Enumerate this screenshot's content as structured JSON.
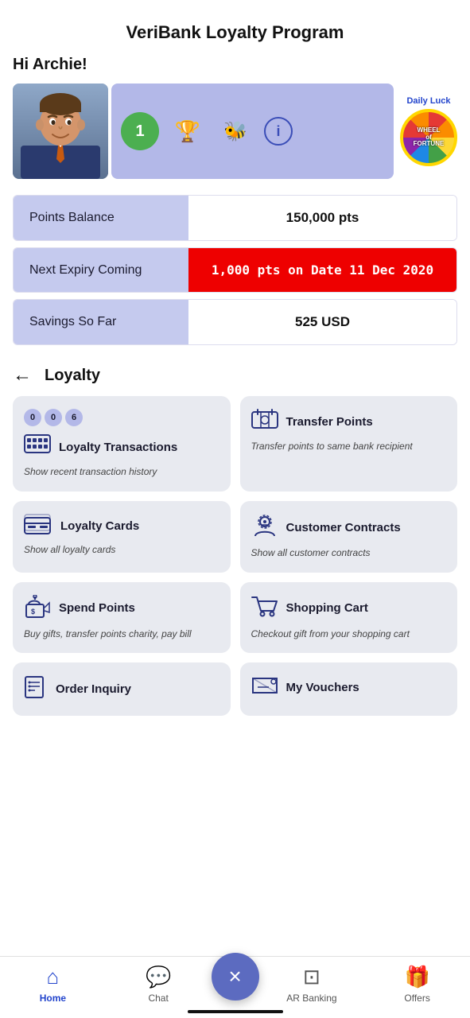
{
  "header": {
    "title": "VeriBank Loyalty Program",
    "greeting": "Hi Archie!"
  },
  "daily_luck": {
    "label": "Daily Luck"
  },
  "wheel_text": "WHEEL of FORTUNE",
  "summary": {
    "points_label": "Points Balance",
    "points_value": "150,000 pts",
    "expiry_label": "Next Expiry Coming",
    "expiry_value": "1,000 pts on Date 11 Dec 2020",
    "savings_label": "Savings So Far",
    "savings_value": "525 USD"
  },
  "loyalty_section": {
    "title": "Loyalty"
  },
  "cards": [
    {
      "id": "loyalty-transactions",
      "title": "Loyalty Transactions",
      "desc": "Show recent transaction history",
      "badges": [
        "0",
        "0",
        "6"
      ]
    },
    {
      "id": "transfer-points",
      "title": "Transfer Points",
      "desc": "Transfer points to same bank recipient",
      "badges": []
    },
    {
      "id": "loyalty-cards",
      "title": "Loyalty Cards",
      "desc": "Show all loyalty cards",
      "badges": []
    },
    {
      "id": "customer-contracts",
      "title": "Customer Contracts",
      "desc": "Show all customer contracts",
      "badges": []
    },
    {
      "id": "spend-points",
      "title": "Spend Points",
      "desc": "Buy gifts, transfer points charity, pay bill",
      "badges": []
    },
    {
      "id": "shopping-cart",
      "title": "Shopping Cart",
      "desc": "Checkout gift from your shopping cart",
      "badges": []
    },
    {
      "id": "order-inquiry",
      "title": "Order Inquiry",
      "desc": "",
      "badges": []
    },
    {
      "id": "my-vouchers",
      "title": "My Vouchers",
      "desc": "",
      "badges": []
    }
  ],
  "nav": {
    "home": "Home",
    "chat": "Chat",
    "ar_banking": "AR Banking",
    "offers": "Offers",
    "fab_icon": "×"
  }
}
